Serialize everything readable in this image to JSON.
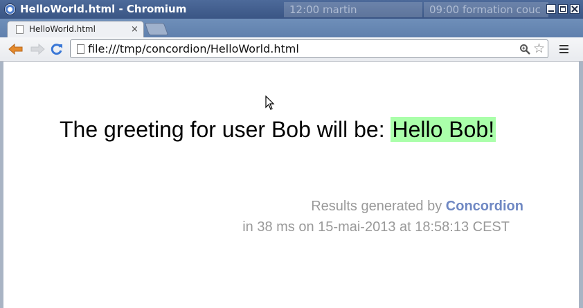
{
  "window": {
    "title": "HelloWorld.html - Chromium",
    "background_calendar": [
      "12:00 martin",
      "09:00 formation couc"
    ]
  },
  "tab": {
    "title": "HelloWorld.html",
    "close_glyph": "×"
  },
  "toolbar": {
    "url": "file:///tmp/concordion/HelloWorld.html",
    "star_glyph": "☆"
  },
  "page": {
    "greeting_text": "The greeting for user Bob will be:",
    "greeting_result": "Hello Bob!",
    "footer_prefix": "Results generated by",
    "footer_link": "Concordion",
    "footer_timing": "in 38 ms on 15-mai-2013 at 18:58:13 CEST"
  },
  "colors": {
    "result_highlight": "#aaffaa",
    "footer_text": "#999999",
    "link": "#6f88c3",
    "titlebar": "#45608f"
  },
  "icons": [
    "chromium-icon",
    "minimize-icon",
    "maximize-icon",
    "close-icon",
    "page-icon",
    "back-arrow-icon",
    "forward-arrow-icon",
    "reload-icon",
    "zoom-icon",
    "star-icon",
    "menu-icon",
    "mouse-cursor-icon"
  ]
}
